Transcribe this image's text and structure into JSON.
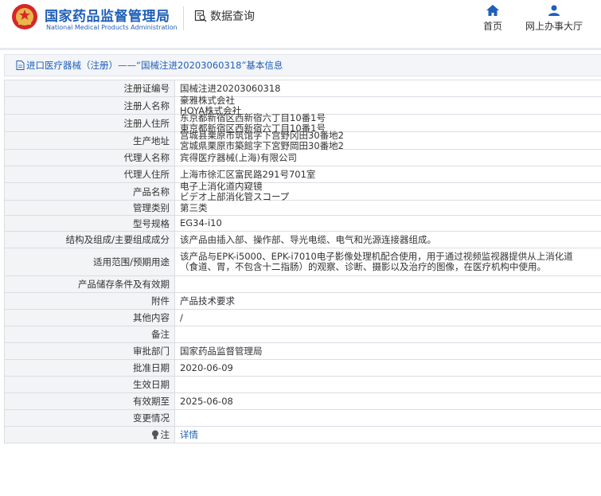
{
  "header": {
    "brand_cn": "国家药品监督管理局",
    "brand_en": "National Medical Products Administration",
    "query_label": "数据查询",
    "nav": [
      {
        "label": "首页",
        "icon": "home-icon"
      },
      {
        "label": "网上办事大厅",
        "icon": "user-icon"
      }
    ],
    "brand_color": "#1f5fb8"
  },
  "title": "进口医疗器械（注册）——“国械注进20203060318”基本信息",
  "rows": [
    {
      "label": "注册证编号",
      "lines": [
        "国械注进20203060318"
      ]
    },
    {
      "label": "注册人名称",
      "lines": [
        "豪雅株式会社",
        "HOYA株式会社"
      ]
    },
    {
      "label": "注册人住所",
      "lines": [
        "东京都新宿区西新宿六丁目10番1号",
        "東京都新宿区西新宿六丁目10番1号"
      ]
    },
    {
      "label": "生产地址",
      "lines": [
        "宫城县栗原市筑馆字下宫野冈田30番地2",
        "宮城県栗原市築館字下宮野岡田30番地2"
      ]
    },
    {
      "label": "代理人名称",
      "lines": [
        "宾得医疗器械(上海)有限公司"
      ]
    },
    {
      "label": "代理人住所",
      "lines": [
        "上海市徐汇区富民路291号701室"
      ]
    },
    {
      "label": "产品名称",
      "lines": [
        "电子上消化道内窥镜",
        "ビデオ上部消化管スコープ"
      ]
    },
    {
      "label": "管理类别",
      "lines": [
        "第三类"
      ]
    },
    {
      "label": "型号规格",
      "lines": [
        "EG34-i10"
      ]
    },
    {
      "label": "结构及组成/主要组成成分",
      "lines": [
        "该产品由插入部、操作部、导光电缆、电气和光源连接器组成。"
      ]
    },
    {
      "label": "适用范围/预期用途",
      "lines": [
        "该产品与EPK-i5000、EPK-i7010电子影像处理机配合使用，用于通过视频监视器提供从上消化道",
        "（食道、胃，不包含十二指肠）的观察、诊断、摄影以及治疗的图像，在医疗机构中使用。"
      ]
    },
    {
      "label": "产品储存条件及有效期",
      "lines": [
        ""
      ]
    },
    {
      "label": "附件",
      "lines": [
        "产品技术要求"
      ]
    },
    {
      "label": "其他内容",
      "lines": [
        "/"
      ]
    },
    {
      "label": "备注",
      "lines": [
        ""
      ]
    },
    {
      "label": "审批部门",
      "lines": [
        "国家药品监督管理局"
      ]
    },
    {
      "label": "批准日期",
      "lines": [
        "2020-06-09"
      ]
    },
    {
      "label": "生效日期",
      "lines": [
        ""
      ]
    },
    {
      "label": "有效期至",
      "lines": [
        "2025-06-08"
      ]
    },
    {
      "label": "变更情况",
      "lines": [
        ""
      ]
    },
    {
      "label": "注",
      "lines": [
        "详情"
      ],
      "link": true,
      "icon": "lightbulb-icon"
    }
  ]
}
